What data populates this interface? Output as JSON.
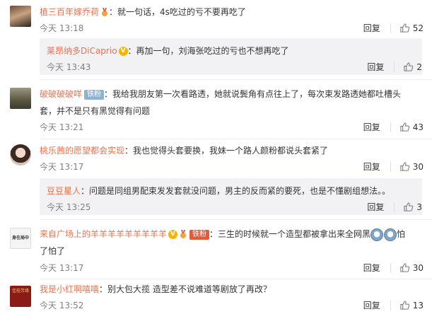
{
  "comments": [
    {
      "name": "植三百年嫁乔荷",
      "text": "：就一句话，4s吃过的亏不要再吃了",
      "time": "今天 13:18",
      "reply_label": "回复",
      "likes": "52",
      "reply": {
        "name": "莱昂纳多DiCaprio",
        "text": "：再加一句，刘海张吃过的亏也不想再吃了",
        "time": "今天 13:43",
        "reply_label": "回复",
        "likes": "2"
      }
    },
    {
      "name": "破破破破咩",
      "badge": "铁粉",
      "text1": "：我给我朋友第一次看路透，她就说鬓角有点往上了，每次束发路透她都吐槽头",
      "text2": "套，并不是只有黑觉得有问题",
      "time": "今天 13:21",
      "reply_label": "回复",
      "likes": "43"
    },
    {
      "name": "桃乐茜的愿望都会实现",
      "text": "：我也觉得头套要换，我妹一个路人颜粉都说头套紧了",
      "time": "今天 13:17",
      "reply_label": "回复",
      "likes": "30",
      "reply": {
        "name": "豆豆星人",
        "text": "：问题是同组男配束发发套就没问题，男主的反而紧的要死，也是不懂剧组想法。。",
        "time": "今天 13:25",
        "reply_label": "回复",
        "likes": "3"
      }
    },
    {
      "name": "来自广场上的羊羊羊羊羊羊羊羊羊",
      "badge": "铁粉",
      "text1": "：三生的时候就一个造型都被拿出来全网黑",
      "text1_end": "怕",
      "text2": "了怕了",
      "avatar_text": "身在局中",
      "time": "今天 13:17",
      "reply_label": "回复",
      "likes": "30"
    },
    {
      "name": "我是小红啊嘻嘻",
      "text": "：别大包大揽 造型差不说难道等剧放了再改？",
      "avatar_text": "佳桂芳缘",
      "time": "今天 13:52",
      "reply_label": "回复",
      "likes": "13"
    }
  ],
  "colors": {
    "name": "#eb7350",
    "panel": "#f2f2f5",
    "meta": "#808080"
  },
  "icons": {
    "like": "thumbs-up-icon",
    "vip": "vip-v-badge",
    "medal": "medal-badge"
  }
}
